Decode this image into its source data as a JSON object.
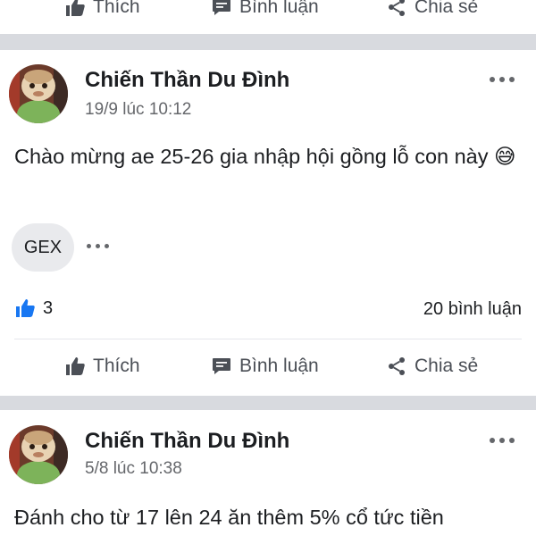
{
  "actions": {
    "like": "Thích",
    "comment": "Bình luận",
    "share": "Chia sẻ"
  },
  "posts": [
    {
      "author": "Chiến Thần Du Đình",
      "time": "19/9 lúc 10:12",
      "text": "Chào mừng ae 25-26 gia nhập hội gồng lỗ con này",
      "emoji": "😅",
      "tag": "GEX",
      "likes": "3",
      "comments": "20 bình luận"
    },
    {
      "author": "Chiến Thần Du Đình",
      "time": "5/8 lúc 10:38",
      "text": "Đánh cho từ 17 lên 24 ăn thêm 5% cổ tức tiền"
    }
  ],
  "colors": {
    "divider": "#d8dadf",
    "like_blue": "#1877f2",
    "icon_gray": "#4b4f56"
  },
  "icons": {
    "like": "thumbs-up-icon",
    "comment": "comment-icon",
    "share": "share-icon",
    "more": "more-options-icon"
  }
}
